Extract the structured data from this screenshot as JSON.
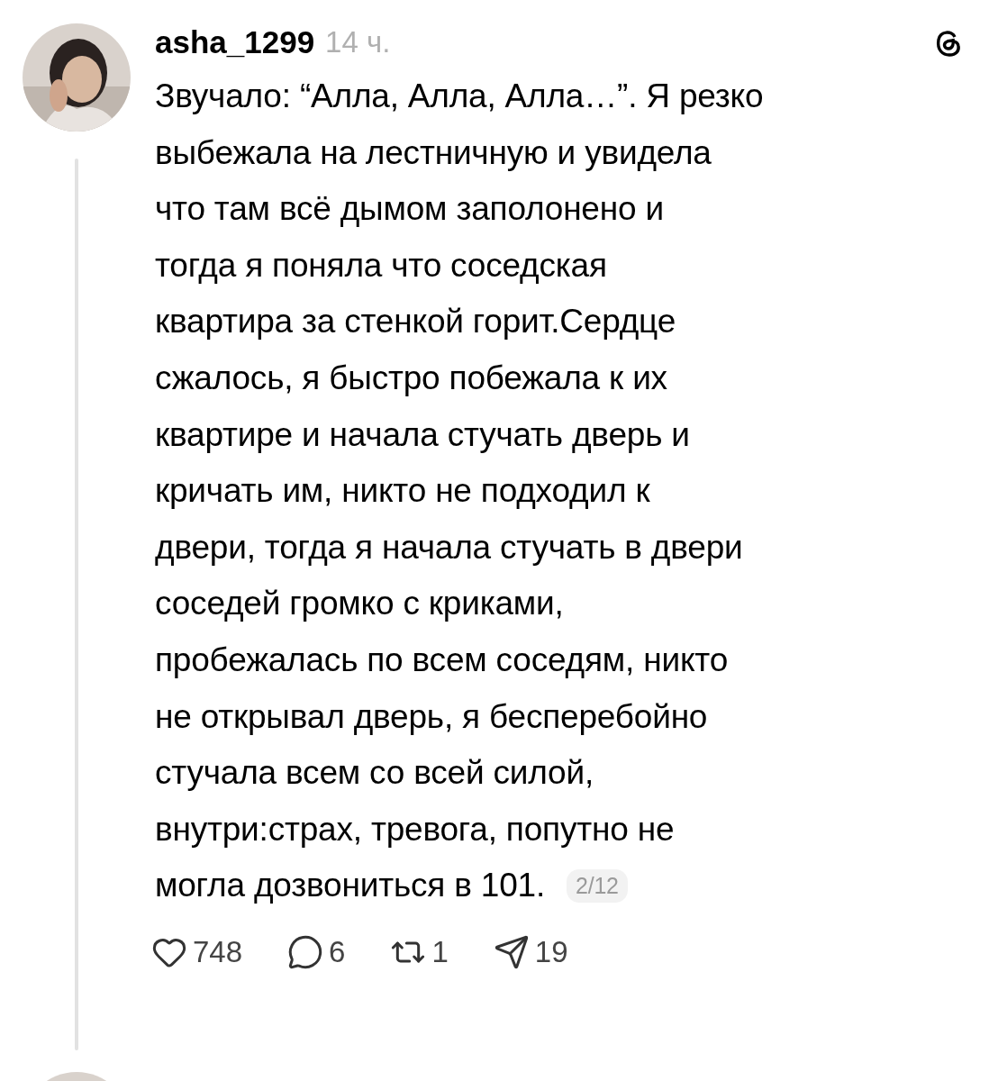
{
  "post": {
    "author": "asha_1299",
    "time": "14 ч.",
    "body_lines": [
      "Звучало: “Алла, Алла, Алла…”. Я резко",
      "выбежала на лестничную и увидела",
      "что там всё дымом заполонено и",
      "тогда я поняла что соседская",
      "квартира за стенкой горит.Сердце",
      "сжалось, я быстро побежала к их",
      "квартире и начала стучать дверь и",
      "кричать им, никто не подходил к",
      "двери, тогда я начала стучать в двери",
      "соседей громко с криками,",
      "пробежалась по всем соседям, никто",
      "не открывал дверь, я бесперебойно",
      "стучала всем со всей силой,",
      "внутри:страх, тревога, попутно не",
      "могла дозвониться в 101."
    ],
    "page_counter": "2/12",
    "actions": [
      {
        "kind": "like",
        "count": "748"
      },
      {
        "kind": "reply",
        "count": "6"
      },
      {
        "kind": "repost",
        "count": "1"
      },
      {
        "kind": "share",
        "count": "19"
      }
    ]
  }
}
